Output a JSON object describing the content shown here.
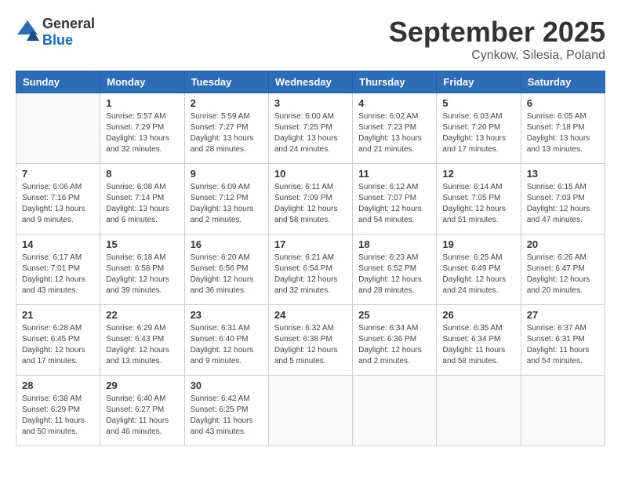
{
  "logo": {
    "general": "General",
    "blue": "Blue"
  },
  "title": "September 2025",
  "location": "Cynkow, Silesia, Poland",
  "weekdays": [
    "Sunday",
    "Monday",
    "Tuesday",
    "Wednesday",
    "Thursday",
    "Friday",
    "Saturday"
  ],
  "weeks": [
    [
      {
        "day": "",
        "info": ""
      },
      {
        "day": "1",
        "info": "Sunrise: 5:57 AM\nSunset: 7:29 PM\nDaylight: 13 hours and 32 minutes."
      },
      {
        "day": "2",
        "info": "Sunrise: 5:59 AM\nSunset: 7:27 PM\nDaylight: 13 hours and 28 minutes."
      },
      {
        "day": "3",
        "info": "Sunrise: 6:00 AM\nSunset: 7:25 PM\nDaylight: 13 hours and 24 minutes."
      },
      {
        "day": "4",
        "info": "Sunrise: 6:02 AM\nSunset: 7:23 PM\nDaylight: 13 hours and 21 minutes."
      },
      {
        "day": "5",
        "info": "Sunrise: 6:03 AM\nSunset: 7:20 PM\nDaylight: 13 hours and 17 minutes."
      },
      {
        "day": "6",
        "info": "Sunrise: 6:05 AM\nSunset: 7:18 PM\nDaylight: 13 hours and 13 minutes."
      }
    ],
    [
      {
        "day": "7",
        "info": "Sunrise: 6:06 AM\nSunset: 7:16 PM\nDaylight: 13 hours and 9 minutes."
      },
      {
        "day": "8",
        "info": "Sunrise: 6:08 AM\nSunset: 7:14 PM\nDaylight: 13 hours and 6 minutes."
      },
      {
        "day": "9",
        "info": "Sunrise: 6:09 AM\nSunset: 7:12 PM\nDaylight: 13 hours and 2 minutes."
      },
      {
        "day": "10",
        "info": "Sunrise: 6:11 AM\nSunset: 7:09 PM\nDaylight: 12 hours and 58 minutes."
      },
      {
        "day": "11",
        "info": "Sunrise: 6:12 AM\nSunset: 7:07 PM\nDaylight: 12 hours and 54 minutes."
      },
      {
        "day": "12",
        "info": "Sunrise: 6:14 AM\nSunset: 7:05 PM\nDaylight: 12 hours and 51 minutes."
      },
      {
        "day": "13",
        "info": "Sunrise: 6:15 AM\nSunset: 7:03 PM\nDaylight: 12 hours and 47 minutes."
      }
    ],
    [
      {
        "day": "14",
        "info": "Sunrise: 6:17 AM\nSunset: 7:01 PM\nDaylight: 12 hours and 43 minutes."
      },
      {
        "day": "15",
        "info": "Sunrise: 6:18 AM\nSunset: 6:58 PM\nDaylight: 12 hours and 39 minutes."
      },
      {
        "day": "16",
        "info": "Sunrise: 6:20 AM\nSunset: 6:56 PM\nDaylight: 12 hours and 36 minutes."
      },
      {
        "day": "17",
        "info": "Sunrise: 6:21 AM\nSunset: 6:54 PM\nDaylight: 12 hours and 32 minutes."
      },
      {
        "day": "18",
        "info": "Sunrise: 6:23 AM\nSunset: 6:52 PM\nDaylight: 12 hours and 28 minutes."
      },
      {
        "day": "19",
        "info": "Sunrise: 6:25 AM\nSunset: 6:49 PM\nDaylight: 12 hours and 24 minutes."
      },
      {
        "day": "20",
        "info": "Sunrise: 6:26 AM\nSunset: 6:47 PM\nDaylight: 12 hours and 20 minutes."
      }
    ],
    [
      {
        "day": "21",
        "info": "Sunrise: 6:28 AM\nSunset: 6:45 PM\nDaylight: 12 hours and 17 minutes."
      },
      {
        "day": "22",
        "info": "Sunrise: 6:29 AM\nSunset: 6:43 PM\nDaylight: 12 hours and 13 minutes."
      },
      {
        "day": "23",
        "info": "Sunrise: 6:31 AM\nSunset: 6:40 PM\nDaylight: 12 hours and 9 minutes."
      },
      {
        "day": "24",
        "info": "Sunrise: 6:32 AM\nSunset: 6:38 PM\nDaylight: 12 hours and 5 minutes."
      },
      {
        "day": "25",
        "info": "Sunrise: 6:34 AM\nSunset: 6:36 PM\nDaylight: 12 hours and 2 minutes."
      },
      {
        "day": "26",
        "info": "Sunrise: 6:35 AM\nSunset: 6:34 PM\nDaylight: 11 hours and 58 minutes."
      },
      {
        "day": "27",
        "info": "Sunrise: 6:37 AM\nSunset: 6:31 PM\nDaylight: 11 hours and 54 minutes."
      }
    ],
    [
      {
        "day": "28",
        "info": "Sunrise: 6:38 AM\nSunset: 6:29 PM\nDaylight: 11 hours and 50 minutes."
      },
      {
        "day": "29",
        "info": "Sunrise: 6:40 AM\nSunset: 6:27 PM\nDaylight: 11 hours and 46 minutes."
      },
      {
        "day": "30",
        "info": "Sunrise: 6:42 AM\nSunset: 6:25 PM\nDaylight: 11 hours and 43 minutes."
      },
      {
        "day": "",
        "info": ""
      },
      {
        "day": "",
        "info": ""
      },
      {
        "day": "",
        "info": ""
      },
      {
        "day": "",
        "info": ""
      }
    ]
  ]
}
